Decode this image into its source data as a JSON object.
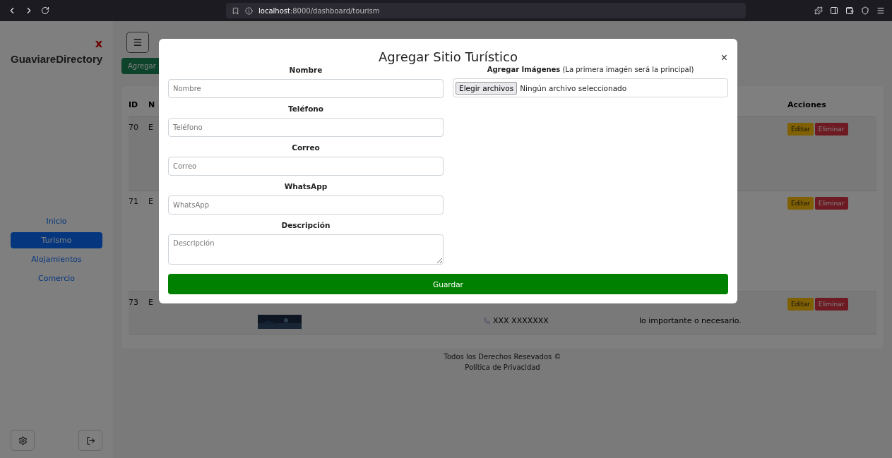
{
  "browser": {
    "url_host": "localhost",
    "url_path": ":8000/dashboard/tourism"
  },
  "sidebar": {
    "close": "x",
    "brand": "GuaviareDirectory",
    "items": [
      {
        "label": "Inicio",
        "selected": false
      },
      {
        "label": "Turismo",
        "selected": true
      },
      {
        "label": "Alojamientos",
        "selected": false
      },
      {
        "label": "Comercio",
        "selected": false
      }
    ]
  },
  "toolbar": {
    "add_button": "Agregar"
  },
  "table": {
    "columns": [
      "ID",
      "N",
      "Acciones"
    ],
    "rows": [
      {
        "id": "70",
        "column_2": "E",
        "actions": [
          "Editar",
          "Eliminar"
        ]
      },
      {
        "id": "71",
        "column_2": "E",
        "actions": [
          "Editar",
          "Eliminar"
        ]
      },
      {
        "id": "73",
        "column_2": "E",
        "has_image": true,
        "contact": "XXX XXXXXXX",
        "description": "lo importante o necesario.",
        "actions": [
          "Editar",
          "Eliminar"
        ]
      }
    ]
  },
  "footer": {
    "rights": "Todos los Derechos Resevados ©",
    "privacy": "Política de Privacidad"
  },
  "modal": {
    "title": "Agregar Sitio Turístico",
    "close": "×",
    "fields": [
      {
        "kind": "input",
        "label": "Nombre",
        "placeholder": "Nombre"
      },
      {
        "kind": "input",
        "label": "Teléfono",
        "placeholder": "Teléfono"
      },
      {
        "kind": "input",
        "label": "Correo",
        "placeholder": "Correo"
      },
      {
        "kind": "input",
        "label": "WhatsApp",
        "placeholder": "WhatsApp"
      },
      {
        "kind": "textarea",
        "label": "Descripción",
        "placeholder": "Descripción"
      }
    ],
    "images": {
      "label": "**Agregar Imágenes** (La primera imagén será la principal)",
      "button": "Elegir archivos",
      "status": "Ningún archivo seleccionado"
    },
    "submit": "Guardar"
  }
}
